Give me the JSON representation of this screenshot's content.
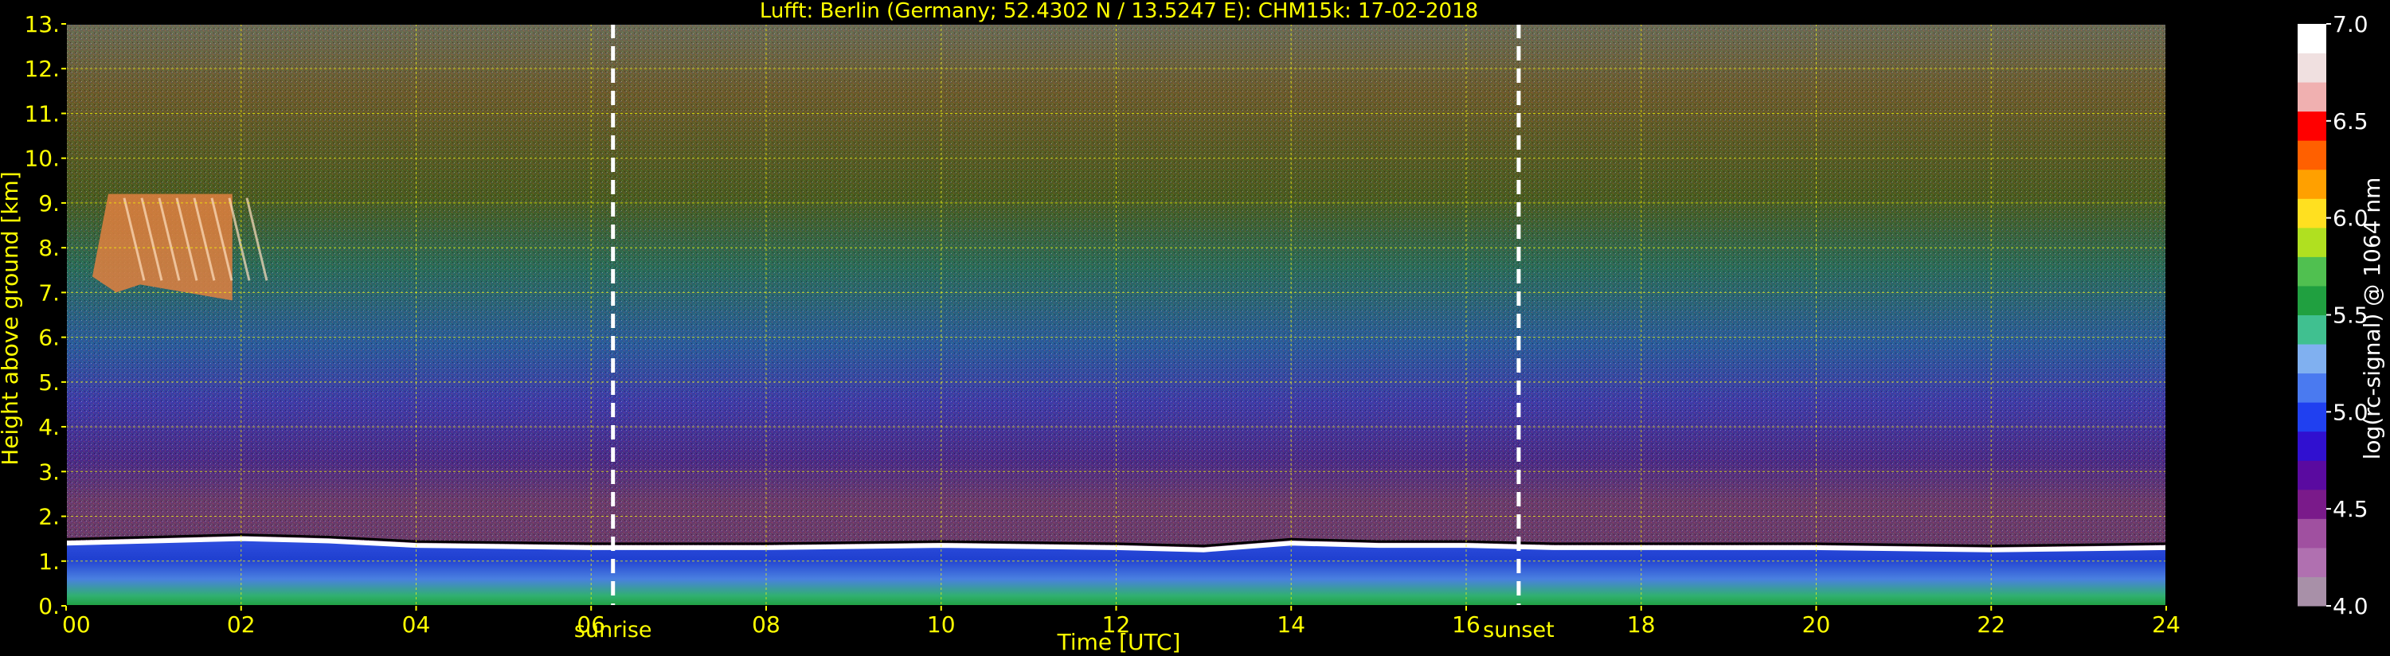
{
  "chart_data": {
    "type": "heatmap",
    "title": "Lufft: Berlin (Germany; 52.4302 N / 13.5247 E):    CHM15k: 17-02-2018",
    "xlabel": "Time [UTC]",
    "ylabel": "Height above ground [km]",
    "xlim": [
      0,
      24
    ],
    "ylim": [
      0,
      13
    ],
    "x_ticks": [
      "00",
      "02",
      "04",
      "06",
      "08",
      "10",
      "12",
      "14",
      "16",
      "18",
      "20",
      "22",
      "24"
    ],
    "y_ticks": [
      "0.",
      "1.",
      "2.",
      "3.",
      "4.",
      "5.",
      "6.",
      "7.",
      "8.",
      "9.",
      "10.",
      "11.",
      "12.",
      "13."
    ],
    "grid": true,
    "grid_color": "#ffff00",
    "text_color": "#ffff00",
    "events": [
      {
        "label": "sunrise",
        "time_utc": 6.25
      },
      {
        "label": "sunset",
        "time_utc": 16.6
      }
    ],
    "boundary_layer_top_km": [
      [
        0,
        1.4
      ],
      [
        1,
        1.45
      ],
      [
        2,
        1.5
      ],
      [
        3,
        1.45
      ],
      [
        4,
        1.35
      ],
      [
        6,
        1.3
      ],
      [
        8,
        1.3
      ],
      [
        10,
        1.35
      ],
      [
        12,
        1.3
      ],
      [
        13,
        1.25
      ],
      [
        14,
        1.4
      ],
      [
        15,
        1.35
      ],
      [
        16,
        1.35
      ],
      [
        17,
        1.3
      ],
      [
        18,
        1.3
      ],
      [
        20,
        1.3
      ],
      [
        22,
        1.25
      ],
      [
        24,
        1.3
      ]
    ],
    "cirrus_layer": {
      "t_start": 0.3,
      "t_end": 1.9,
      "h_bottom_km": 7.0,
      "h_top_km": 9.2
    },
    "colorbar": {
      "label": "log(rc-signal) @ 1064 nm",
      "range": [
        4.0,
        7.0
      ],
      "ticks": [
        "4.0",
        "4.5",
        "5.0",
        "5.5",
        "6.0",
        "6.5",
        "7.0"
      ],
      "colors": [
        "#a890a8",
        "#b070b0",
        "#a050a0",
        "#7a1a8a",
        "#5a0aa0",
        "#3010d0",
        "#2040f0",
        "#4a7af0",
        "#80b0f0",
        "#40c090",
        "#20a040",
        "#50c050",
        "#b0e020",
        "#ffe020",
        "#ffa000",
        "#ff6000",
        "#ff0000",
        "#f0b0b0",
        "#f0e0e0",
        "#ffffff"
      ]
    }
  }
}
